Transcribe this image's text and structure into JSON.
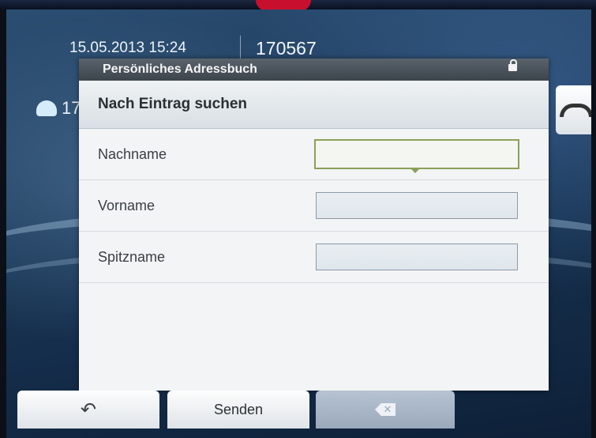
{
  "status": {
    "datetime": "15.05.2013 15:24",
    "extension": "170567"
  },
  "line_key": {
    "label": "17"
  },
  "dialog": {
    "title": "Persönliches Adressbuch",
    "header": "Nach Eintrag suchen",
    "fields": [
      {
        "label": "Nachname",
        "value": ""
      },
      {
        "label": "Vorname",
        "value": ""
      },
      {
        "label": "Spitzname",
        "value": ""
      }
    ]
  },
  "softkeys": {
    "back_icon": "back-arrow-icon",
    "send_label": "Senden",
    "delete_icon": "backspace-icon"
  },
  "colors": {
    "active_field_border": "#8aa05a",
    "title_bar": "#4a525a",
    "brand_red": "#c8102e"
  }
}
